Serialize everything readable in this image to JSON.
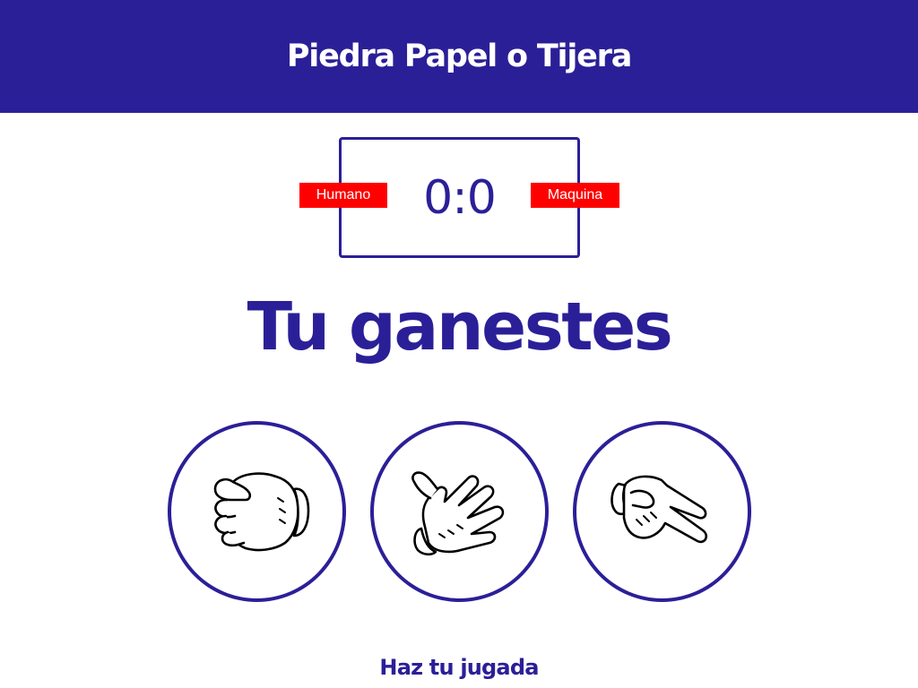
{
  "header": {
    "title": "Piedra Papel o Tijera"
  },
  "scoreboard": {
    "user_label": "Humano",
    "computer_label": "Maquina",
    "score": "0:0"
  },
  "result": {
    "message": "Tu ganestes"
  },
  "choices": [
    {
      "id": "r",
      "icon": "rock-hand-icon"
    },
    {
      "id": "p",
      "icon": "paper-hand-icon"
    },
    {
      "id": "s",
      "icon": "scissors-hand-icon"
    }
  ],
  "action": {
    "message": "Haz tu jugada"
  },
  "colors": {
    "primary": "#2b1f98",
    "badge": "#ff0000"
  }
}
